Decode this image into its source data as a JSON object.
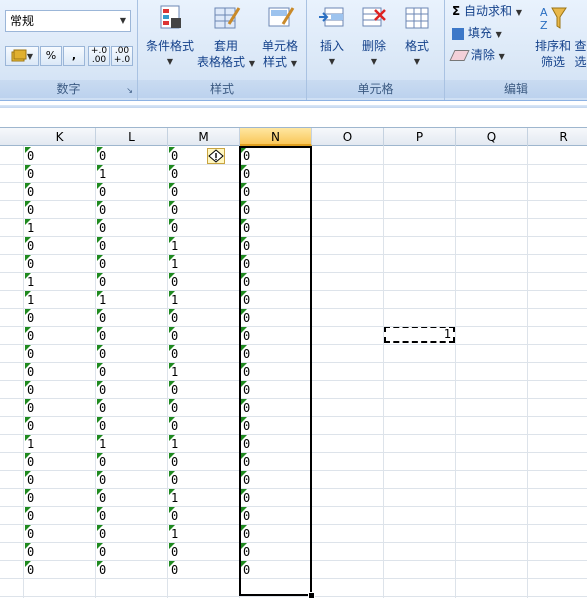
{
  "ribbon": {
    "number_format": "常规",
    "number_group": "数字",
    "styles_group": "样式",
    "cells_group": "单元格",
    "editing_group": "编辑",
    "pct_label": "%",
    "comma_label": ",",
    "inc_decimal": "+.0 .00",
    "dec_decimal": ".00 +.0",
    "cond_format": [
      "条件格式"
    ],
    "table_format": [
      "套用",
      "表格格式"
    ],
    "cell_style": [
      "单元格",
      "样式"
    ],
    "insert": "插入",
    "delete": "删除",
    "format": "格式",
    "autosum": "自动求和",
    "fill": "填充",
    "clear": "清除",
    "sort_filter": [
      "排序和",
      "筛选"
    ],
    "find_select": [
      "查",
      "选"
    ]
  },
  "columns": [
    "K",
    "L",
    "M",
    "N",
    "O",
    "P",
    "Q",
    "R"
  ],
  "selected_column": "N",
  "rows": {
    "K": [
      "0",
      "0",
      "0",
      "0",
      "1",
      "0",
      "0",
      "1",
      "1",
      "0",
      "0",
      "0",
      "0",
      "0",
      "0",
      "0",
      "1",
      "0",
      "0",
      "0",
      "0",
      "0",
      "0",
      "0"
    ],
    "L": [
      "0",
      "1",
      "0",
      "0",
      "0",
      "0",
      "0",
      "0",
      "1",
      "0",
      "0",
      "0",
      "0",
      "0",
      "0",
      "0",
      "1",
      "0",
      "0",
      "0",
      "0",
      "0",
      "0",
      "0"
    ],
    "M": [
      "0",
      "0",
      "0",
      "0",
      "0",
      "1",
      "1",
      "0",
      "1",
      "0",
      "0",
      "0",
      "1",
      "0",
      "0",
      "0",
      "1",
      "0",
      "0",
      "1",
      "0",
      "1",
      "0",
      "0"
    ],
    "N": [
      "0",
      "0",
      "0",
      "0",
      "0",
      "0",
      "0",
      "0",
      "0",
      "0",
      "0",
      "0",
      "0",
      "0",
      "0",
      "0",
      "0",
      "0",
      "0",
      "0",
      "0",
      "0",
      "0",
      "0"
    ]
  },
  "copy_marquee_value": "1",
  "colors": {
    "ribbon_bg": "#dbe8f7",
    "selected_header": "#f9c75a",
    "error_triangle": "#1f8a1f"
  }
}
